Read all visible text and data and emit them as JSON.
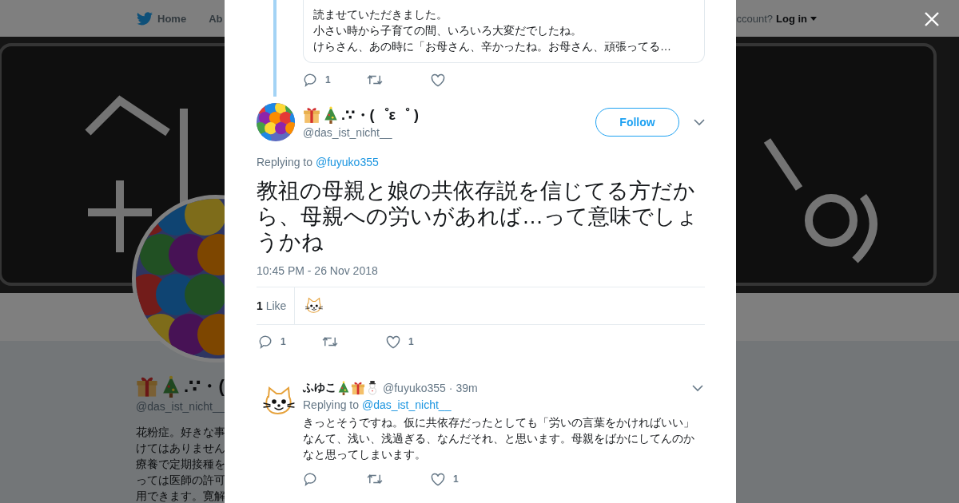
{
  "background_page": {
    "nav_items": [
      {
        "label": "Home",
        "kind": "home"
      },
      {
        "label": "Ab",
        "kind": "text"
      }
    ],
    "account_prompt": "ccount?",
    "login": "Log in",
    "profile": {
      "name": ".∵・(",
      "handle": "@das_ist_nicht__",
      "bio_lines": [
        "花粉症。好きな事",
        "けてはありません",
        "療養で定期接種を",
        "っては医師の許可",
        "用できます。寛解"
      ]
    }
  },
  "modal": {
    "quoted_tweet": {
      "text_lines": [
        "読ませていただきました。",
        "小さい時から子育ての間、いろいろ大変だでしたね。",
        "けらさん、あの時に「お母さん、辛かったね。お母さん、頑張ってる…"
      ],
      "actions": [
        {
          "kind": "reply",
          "count": "1"
        },
        {
          "kind": "retweet"
        },
        {
          "kind": "like"
        }
      ]
    },
    "tweet": {
      "name": ".∵・(゜ε゜ )",
      "handle": "@das_ist_nicht__",
      "follow_label": "Follow",
      "replying_label": "Replying to",
      "replying_to": "@fuyuko355",
      "text": "教祖の母親と娘の共依存説を信じてる方だから、母親への労いがあれば…って意味でしょうかね",
      "timestamp": "10:45 PM - 26 Nov 2018",
      "likes_count": "1",
      "likes_label": "Like",
      "actions": [
        {
          "kind": "reply",
          "count": "1"
        },
        {
          "kind": "retweet"
        },
        {
          "kind": "like",
          "count": "1"
        }
      ]
    },
    "reply": {
      "name": "ふゆこ",
      "handle": "@fuyuko355",
      "separator": "·",
      "age": "39m",
      "replying_label": "Replying to",
      "replying_to": "@das_ist_nicht__",
      "text": "きっとそうですね。仮に共依存だったとしても「労いの言葉をかければいい」なんて、浅い、浅過ぎる、なんだそれ、と思います。母親をばかにしてんのかなと思ってしまいます。",
      "actions": [
        {
          "kind": "reply"
        },
        {
          "kind": "retweet"
        },
        {
          "kind": "like",
          "count": "1"
        }
      ]
    }
  }
}
